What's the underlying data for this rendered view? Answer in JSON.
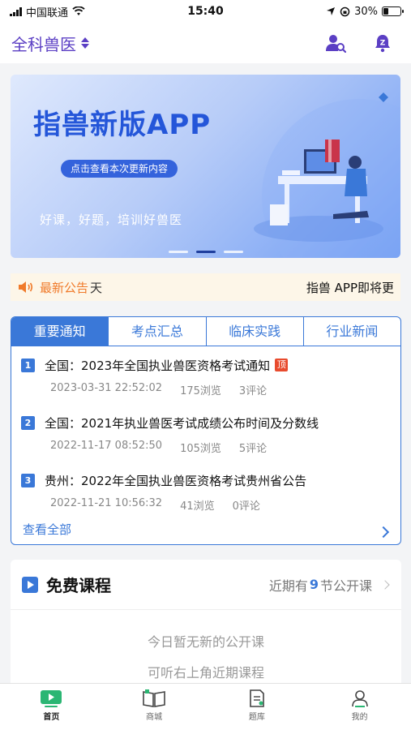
{
  "status_bar": {
    "carrier": "中国联通",
    "time": "15:40",
    "battery": "30%",
    "battery_level": 0.3
  },
  "header": {
    "title": "全科兽医"
  },
  "banner": {
    "title": "指兽新版APP",
    "button": "点击查看本次更新内容",
    "subtitle": "好课，好题，培训好兽医",
    "slide_count": 3,
    "active_slide": 2
  },
  "notice": {
    "label": "最新公告",
    "fragment": "天",
    "text": "指兽 APP即将更"
  },
  "news": {
    "tabs": [
      "重要通知",
      "考点汇总",
      "临床实践",
      "行业新闻"
    ],
    "active_tab": 0,
    "items": [
      {
        "num": "1",
        "title": "全国：2023年全国执业兽医资格考试通知",
        "tag": "顶",
        "date": "2023-03-31 22:52:02",
        "views": "175浏览",
        "comments": "3评论"
      },
      {
        "num": "2",
        "title": "全国：2021年执业兽医考试成绩公布时间及分数线",
        "tag": "",
        "date": "2022-11-17 08:52:50",
        "views": "105浏览",
        "comments": "5评论"
      },
      {
        "num": "3",
        "title": "贵州：2022年全国执业兽医资格考试贵州省公告",
        "tag": "",
        "date": "2022-11-21 10:56:32",
        "views": "41浏览",
        "comments": "0评论"
      }
    ],
    "view_all": "查看全部"
  },
  "courses": {
    "title": "免费课程",
    "more_prefix": "近期有",
    "more_count": "9",
    "more_suffix": "节公开课",
    "empty_line1": "今日暂无新的公开课",
    "empty_line2": "可听右上角近期课程"
  },
  "nav": {
    "home": "首页",
    "shop": "商城",
    "questions": "题库",
    "mine": "我的"
  },
  "colors": {
    "brand_purple": "#5b3fc4",
    "accent_blue": "#3a78d8",
    "notice_orange": "#f07a2a",
    "home_green": "#2bb673"
  }
}
